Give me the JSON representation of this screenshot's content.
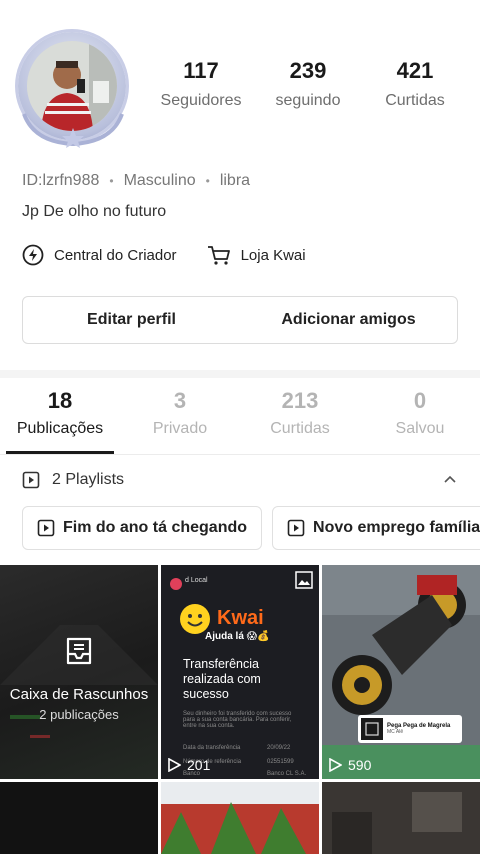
{
  "profile": {
    "stats": [
      {
        "value": "117",
        "label": "Seguidores"
      },
      {
        "value": "239",
        "label": "seguindo"
      },
      {
        "value": "421",
        "label": "Curtidas"
      }
    ],
    "id_text": "ID:lzrfn988",
    "gender": "Masculino",
    "sign": "libra",
    "bio": "Jp De olho no futuro"
  },
  "links": {
    "creator_center": "Central do Criador",
    "shop": "Loja Kwai"
  },
  "actions": {
    "edit_profile": "Editar perfil",
    "add_friends": "Adicionar amigos"
  },
  "tabs": [
    {
      "count": "18",
      "label": "Publicações"
    },
    {
      "count": "3",
      "label": "Privado"
    },
    {
      "count": "213",
      "label": "Curtidas"
    },
    {
      "count": "0",
      "label": "Salvou"
    }
  ],
  "playlists": {
    "header": "2 Playlists",
    "items": [
      "Fim do ano tá chegando",
      "Novo emprego família"
    ]
  },
  "grid": {
    "drafts_title": "Caixa de Rascunhos",
    "drafts_count": "2 publicações",
    "post1": {
      "views": "201",
      "sender": "d Local",
      "brand": "Kwai",
      "help": "Ajuda lá 😱💰",
      "title": "Transferência realizada com sucesso",
      "note": "Seu dinheiro foi transferido com sucesso para a sua conta bancária. Para conferir, entre na sua conta.",
      "date_label": "Data da transferência",
      "date": "20/09/22",
      "ref_label": "Número de referência",
      "ref": "02551599",
      "bank_label": "Banco",
      "bank": "Banco CL S.A."
    },
    "post2": {
      "views": "590",
      "song_title": "Pega Pega de Magrela",
      "song_artist": "MC Alê"
    }
  },
  "colors": {
    "accent": "#1a1a1a",
    "muted_text": "#b4b4b4",
    "kwai_orange": "#ff6a1a"
  }
}
